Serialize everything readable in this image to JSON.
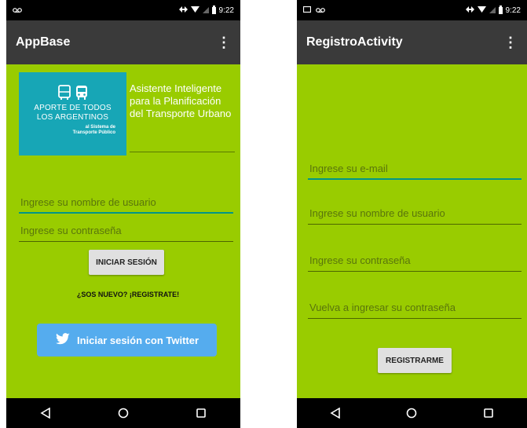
{
  "status_bar": {
    "time": "9:22"
  },
  "login_screen": {
    "title": "AppBase",
    "overflow_icon": "more-vert-icon",
    "logo": {
      "line1": "APORTE DE TODOS",
      "line2": "LOS ARGENTINOS",
      "line3": "al Sistema de",
      "line4": "Transporte Público"
    },
    "app_description": "Asistente Inteligente para la Planificación del Transporte Urbano",
    "username_placeholder": "Ingrese su nombre de usuario",
    "password_placeholder": "Ingrese su contraseña",
    "login_button": "INICIAR SESIÓN",
    "register_link": "¿SOS NUEVO? ¡REGISTRATE!",
    "twitter_button": "Iniciar sesión con Twitter"
  },
  "register_screen": {
    "title": "RegistroActivity",
    "email_placeholder": "Ingrese su e-mail",
    "username_placeholder": "Ingrese su nombre de usuario",
    "password_placeholder": "Ingrese su contraseña",
    "password_confirm_placeholder": "Vuelva a ingresar su contraseña",
    "register_button": "REGISTRARME"
  },
  "nav_icons": [
    "back-icon",
    "home-icon",
    "recents-icon"
  ],
  "colors": {
    "background": "#99cc00",
    "appbar": "#3a3a3a",
    "logo": "#17a6b6",
    "twitter": "#55acee",
    "accent": "#009688"
  }
}
